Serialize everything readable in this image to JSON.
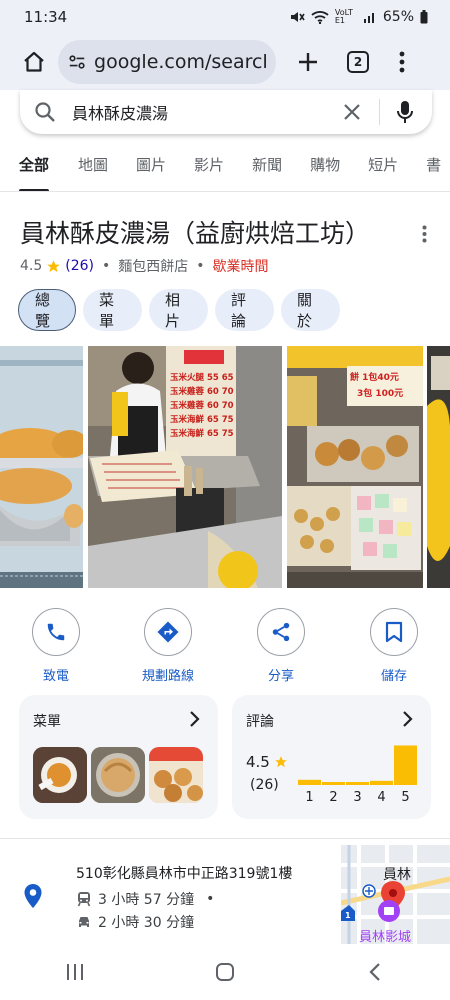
{
  "status": {
    "time": "11:34",
    "network": "VoLTE1",
    "battery": "65%"
  },
  "browser": {
    "url": "google.com/search?",
    "tab_count": "2"
  },
  "search": {
    "query": "員林酥皮濃湯"
  },
  "filter_tabs": [
    "全部",
    "地圖",
    "圖片",
    "影片",
    "新聞",
    "購物",
    "短片",
    "書"
  ],
  "place": {
    "title": "員林酥皮濃湯（益廚烘焙工坊）",
    "rating": "4.5",
    "review_count": "(26)",
    "separator": "•",
    "category": "麵包西餅店",
    "hours_label": "歇業時間"
  },
  "chips": [
    "總覽",
    "菜單",
    "相片",
    "評論",
    "關於"
  ],
  "photos": {
    "price_sign_lines": [
      "玉米火腿 55 65",
      "玉米雞蓉 60 70",
      "玉米雞蓉 60 70",
      "玉米海鮮 65 75",
      "玉米海鮮 65 75"
    ],
    "snack_sign_lines": [
      "餅 1包40元",
      "3包 100元"
    ]
  },
  "actions": [
    {
      "label": "致電",
      "icon": "phone-icon"
    },
    {
      "label": "規劃路線",
      "icon": "directions-icon"
    },
    {
      "label": "分享",
      "icon": "share-icon"
    },
    {
      "label": "儲存",
      "icon": "bookmark-icon"
    }
  ],
  "menu_card": {
    "title": "菜單"
  },
  "review_card": {
    "title": "評論",
    "rating": "4.5",
    "count": "(26)",
    "chart_data": {
      "type": "bar",
      "categories": [
        "1",
        "2",
        "3",
        "4",
        "5"
      ],
      "values": [
        0.1,
        0.03,
        0.03,
        0.08,
        0.76
      ],
      "ylim": [
        0,
        1
      ]
    }
  },
  "address": {
    "line": "510彰化縣員林市中正路319號1樓",
    "transit_time": "3 小時 57 分鐘",
    "transit_dot": "•",
    "drive_time": "2 小時 30 分鐘"
  },
  "map": {
    "city_label": "員林",
    "poi_label": "員林影城",
    "route_shield": "1"
  },
  "colors": {
    "accent_blue": "#1a5cc7",
    "star": "#fbbc04",
    "closed_red": "#d93025",
    "bar": "#fbbc04",
    "bar_track": "#e0e0e0"
  }
}
